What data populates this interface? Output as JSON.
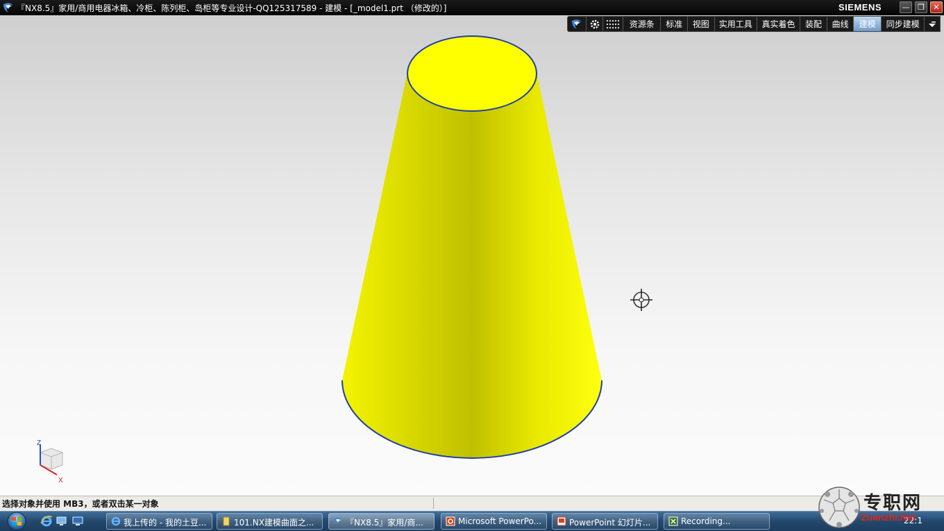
{
  "window": {
    "title": "『NX8.5』家用/商用电器冰箱、冷柜、陈列柜、岛柜等专业设计-QQ125317589 - 建模 - [_model1.prt （修改的）]",
    "brand": "SIEMENS",
    "min_glyph": "—",
    "max_glyph": "❐",
    "close_glyph": "✕"
  },
  "ribbon": {
    "tabs": [
      {
        "label": "资源条",
        "active": false
      },
      {
        "label": "标准",
        "active": false
      },
      {
        "label": "视图",
        "active": false
      },
      {
        "label": "实用工具",
        "active": false
      },
      {
        "label": "真实着色",
        "active": false
      },
      {
        "label": "装配",
        "active": false
      },
      {
        "label": "曲线",
        "active": false
      },
      {
        "label": "建模",
        "active": true
      },
      {
        "label": "同步建模",
        "active": false
      }
    ],
    "icons": [
      "nx-logo-icon",
      "gear-icon",
      "grid-icon",
      "dropdown-arrow-icon"
    ]
  },
  "model": {
    "shape": "truncated-cone",
    "fill_color": "#ffff00",
    "shade_color": "#b8b800",
    "edge_color": "#1f3fa6"
  },
  "triad": {
    "z_label": "Z",
    "x_label": "X"
  },
  "statusbar": {
    "text": "选择对象并使用 MB3，或者双击某一对象"
  },
  "taskbar": {
    "buttons": [
      {
        "label": "我上传的 - 我的土豆...",
        "icon": "ie-icon",
        "active": false
      },
      {
        "label": "101.NX建模曲面之...",
        "icon": "folder-icon",
        "active": false
      },
      {
        "label": "『NX8.5』家用/商...",
        "icon": "nx-logo-icon",
        "active": true
      },
      {
        "label": "Microsoft PowerPo...",
        "icon": "powerpoint-icon",
        "active": false
      },
      {
        "label": "PowerPoint 幻灯片...",
        "icon": "powerpoint-slide-icon",
        "active": false
      },
      {
        "label": "Recording...",
        "icon": "recording-icon",
        "active": false
      }
    ],
    "clock": "22:1"
  },
  "watermark": {
    "cn_text": "专职网",
    "url": "Zuanzhi.Net"
  }
}
